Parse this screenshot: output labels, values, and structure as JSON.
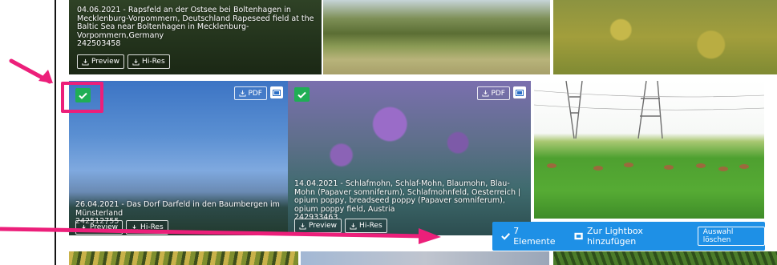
{
  "tiles": [
    {
      "caption": "04.06.2021 - Rapsfeld an der Ostsee bei Boltenhagen in Mecklenburg-Vorpommern, Deutschland Rapeseed field at the Baltic Sea near Boltenhagen in Mecklenburg-Vorpommern,Germany",
      "id": "242503458",
      "preview": "Preview",
      "hires": "Hi-Res"
    },
    {
      "caption": "26.04.2021 - Das Dorf Darfeld in den Baumbergen im Münsterland",
      "id": "242512755",
      "preview": "Preview",
      "hires": "Hi-Res",
      "pdf": "PDF"
    },
    {
      "caption": "14.04.2021 - Schlafmohn, Schlaf-Mohn, Blaumohn, Blau-Mohn (Papaver somniferum), Schlafmohnfeld, Oesterreich | opium poppy, breadseed poppy (Papaver somniferum), opium poppy field, Austria",
      "id": "242933463",
      "preview": "Preview",
      "hires": "Hi-Res",
      "pdf": "PDF"
    }
  ],
  "selection_bar": {
    "count_label": "7 Elemente",
    "add_lightbox_label": "Zur Lightbox hinzufügen",
    "clear_label": "Auswahl löschen"
  },
  "colors": {
    "accent": "#1e90e6",
    "annotation": "#ec1f7a",
    "check": "#1fae55"
  },
  "icons": [
    "download-icon",
    "lightbox-icon",
    "checkmark-icon",
    "annotation-arrow"
  ]
}
